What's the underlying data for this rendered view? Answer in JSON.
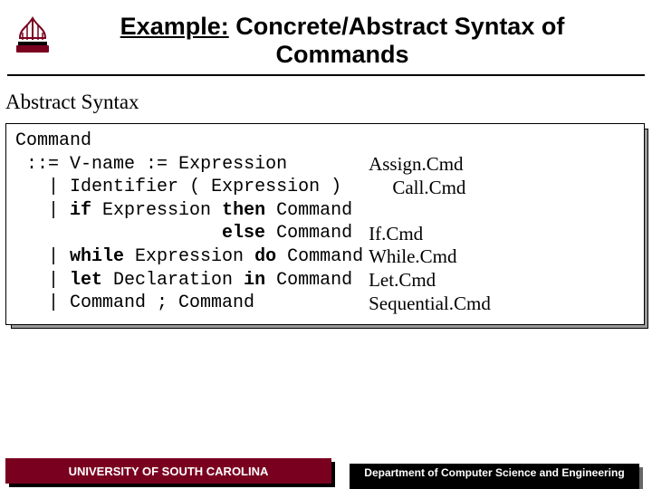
{
  "title": {
    "underlined": "Example:",
    "rest": " Concrete/Abstract Syntax of Commands"
  },
  "section": "Abstract Syntax",
  "grammar": {
    "head": "Command",
    "lines": [
      {
        "prefix": " ::= ",
        "tokens": [
          {
            "t": "V-name"
          },
          {
            "t": " "
          },
          {
            "t": ":="
          },
          {
            "t": " "
          },
          {
            "t": "Expression"
          }
        ]
      },
      {
        "prefix": "   | ",
        "tokens": [
          {
            "t": "Identifier"
          },
          {
            "t": " "
          },
          {
            "t": "("
          },
          {
            "t": " "
          },
          {
            "t": "Expression"
          },
          {
            "t": " "
          },
          {
            "t": ")"
          }
        ]
      },
      {
        "prefix": "   | ",
        "tokens": [
          {
            "t": "if",
            "b": true
          },
          {
            "t": " Expression "
          },
          {
            "t": "then",
            "b": true
          },
          {
            "t": " Command"
          }
        ]
      },
      {
        "prefix": "                   ",
        "tokens": [
          {
            "t": "else",
            "b": true
          },
          {
            "t": " Command"
          }
        ]
      },
      {
        "prefix": "   | ",
        "tokens": [
          {
            "t": "while",
            "b": true
          },
          {
            "t": " Expression "
          },
          {
            "t": "do",
            "b": true
          },
          {
            "t": " Command"
          }
        ]
      },
      {
        "prefix": "   | ",
        "tokens": [
          {
            "t": "let",
            "b": true
          },
          {
            "t": " Declaration "
          },
          {
            "t": "in",
            "b": true
          },
          {
            "t": " Command"
          }
        ]
      },
      {
        "prefix": "   | ",
        "tokens": [
          {
            "t": "Command "
          },
          {
            "t": ";"
          },
          {
            "t": " Command"
          }
        ]
      }
    ]
  },
  "labels": [
    "Assign.Cmd",
    "     Call.Cmd",
    "",
    "If.Cmd",
    "While.Cmd",
    "Let.Cmd",
    "Sequential.Cmd"
  ],
  "footer": {
    "left": "UNIVERSITY OF SOUTH CAROLINA",
    "right": "Department of Computer Science and Engineering"
  },
  "logo": {
    "name": "university-of-south-carolina-logo"
  }
}
